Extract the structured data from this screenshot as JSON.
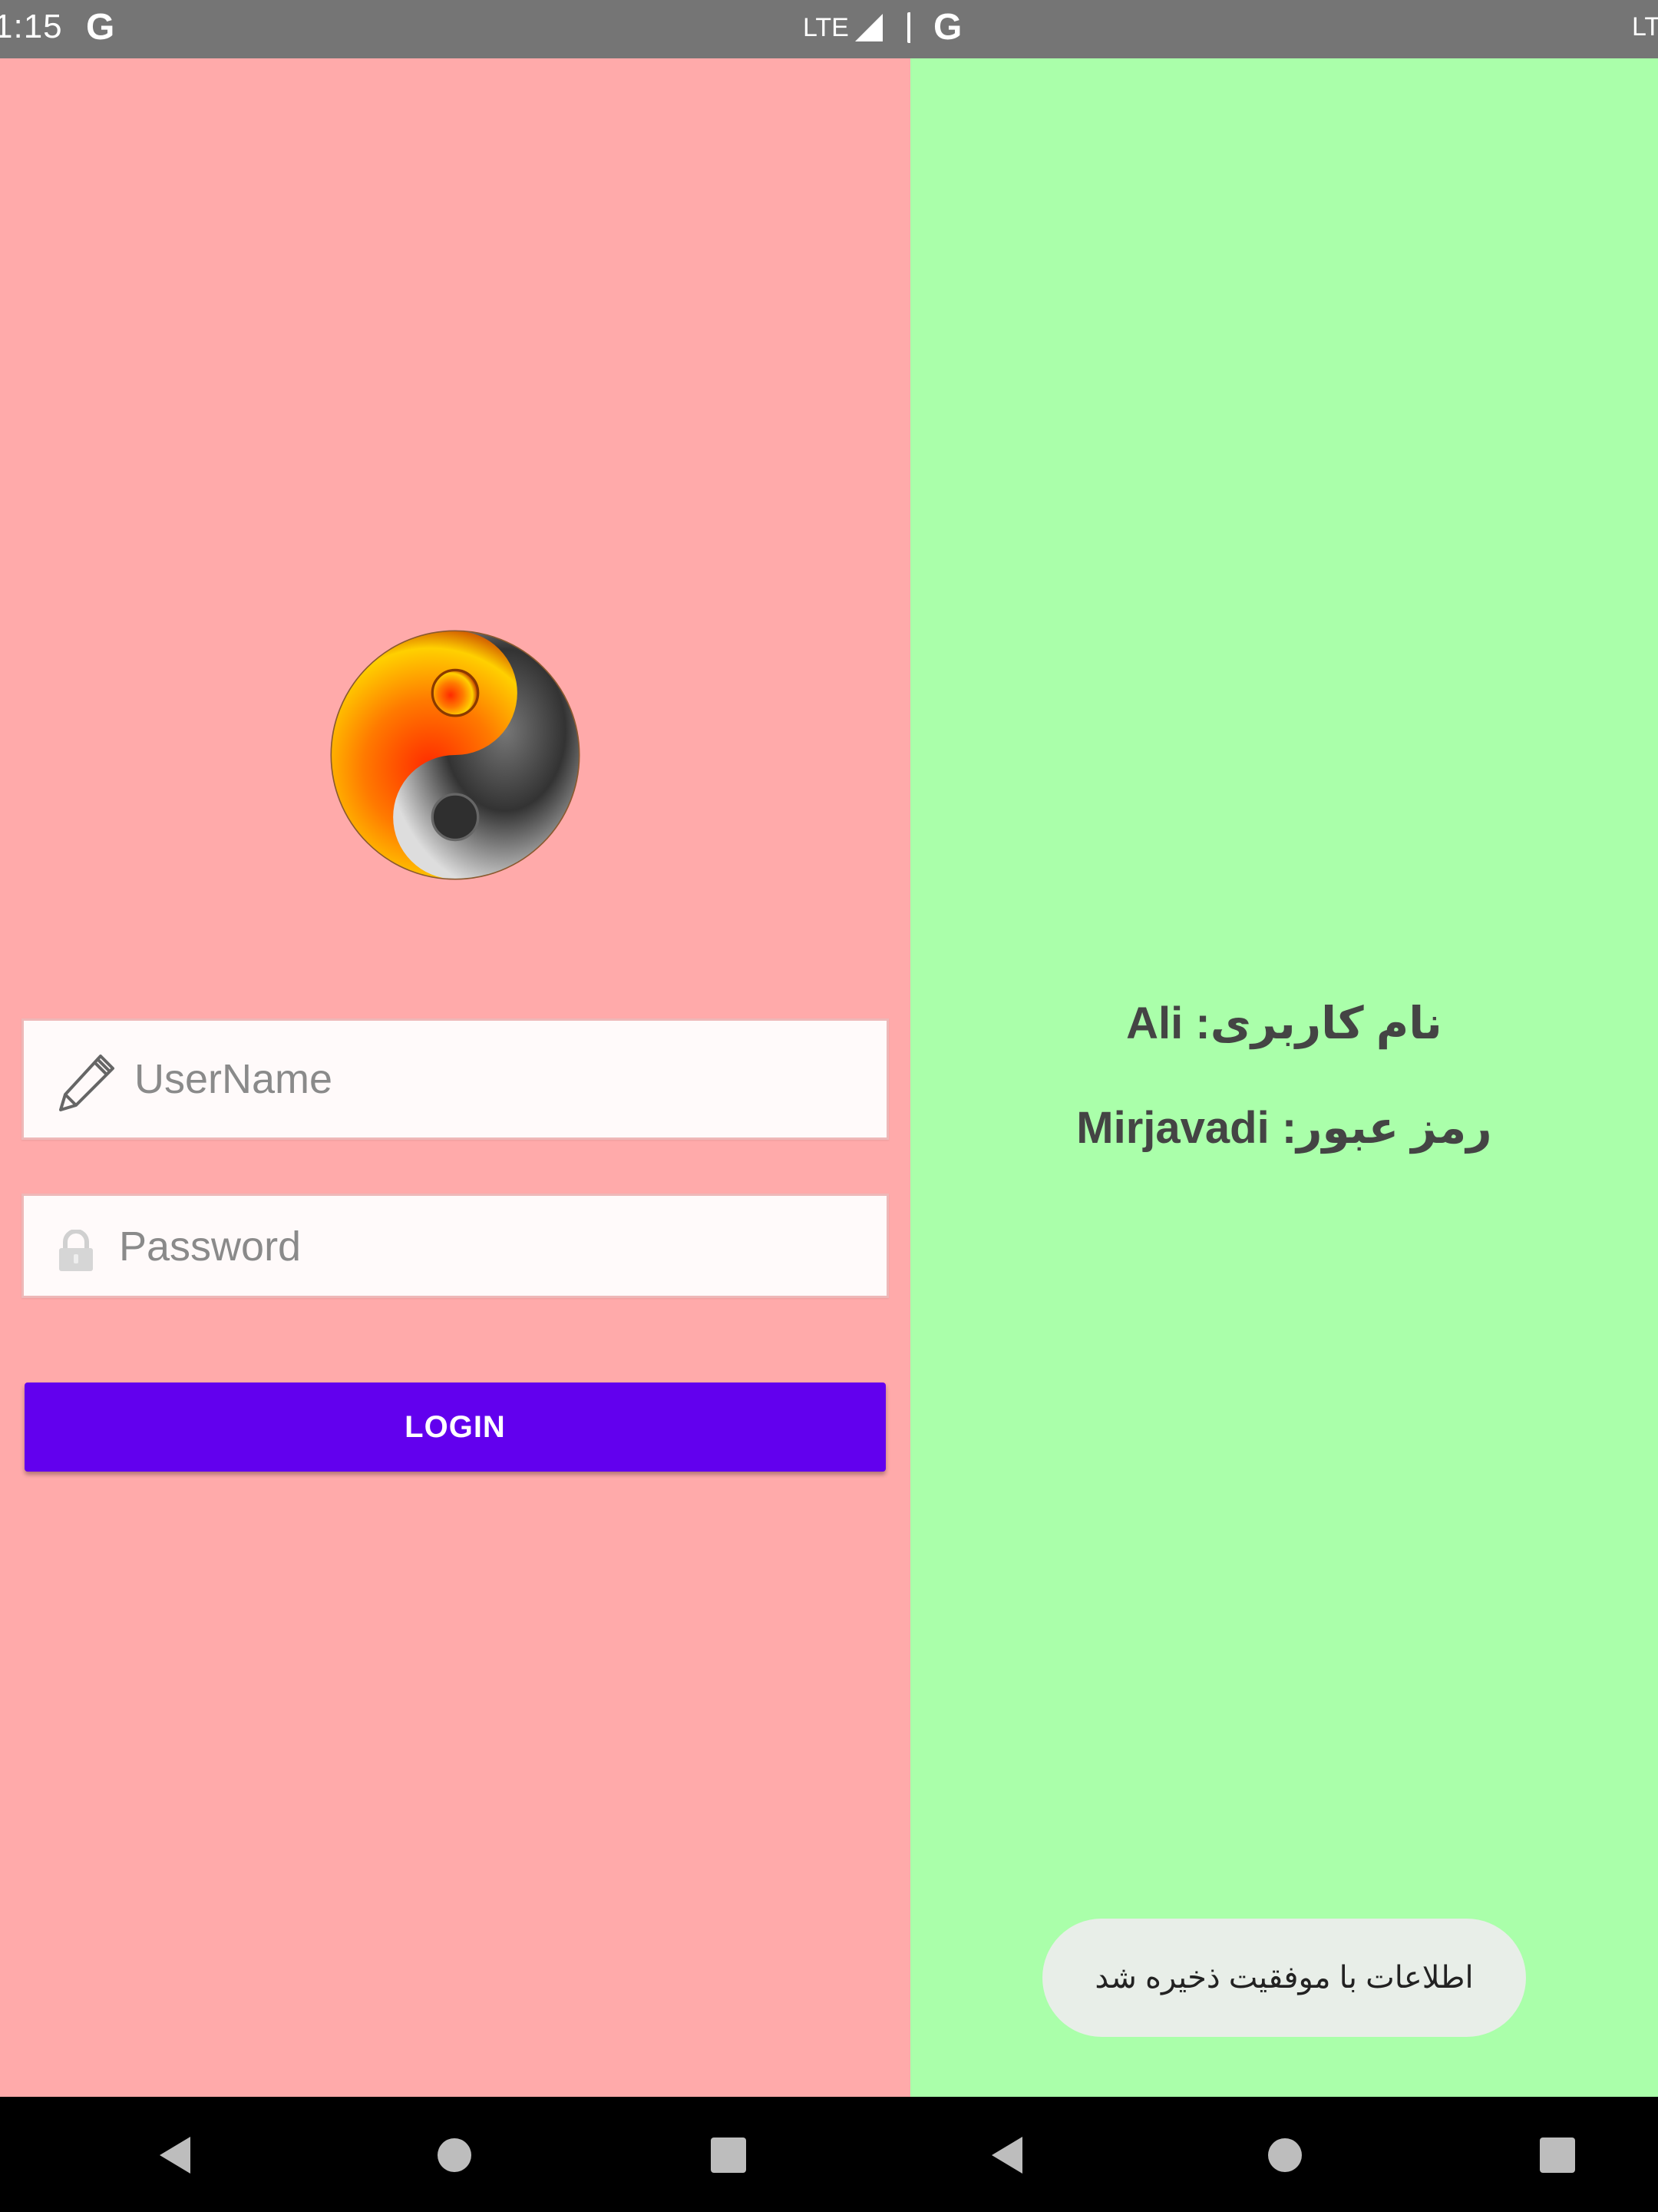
{
  "left_screen": {
    "status_bar": {
      "time": "1:15",
      "google_icon": "G",
      "network": "LTE",
      "signal_icon": "signal-icon",
      "battery_icon": "battery-icon"
    },
    "logo": {
      "icon": "yin-yang-fire-moon-logo"
    },
    "username": {
      "placeholder": "UserName",
      "icon": "pencil-icon"
    },
    "password": {
      "placeholder": "Password",
      "icon": "lock-icon"
    },
    "login_button": {
      "label": "LOGIN"
    },
    "background": "#ffaaaa",
    "accent": "#6200ee"
  },
  "right_screen": {
    "status_bar": {
      "google_icon": "G",
      "network": "LT"
    },
    "username_label": "نام کاربری:",
    "username_value": "Ali",
    "password_label": "رمز عبور:",
    "password_value": "Mirjavadi",
    "toast": "اطلاعات با موفقیت ذخیره شد",
    "background": "#aaffaa"
  },
  "nav_bar": {
    "back_icon": "back-icon",
    "home_icon": "home-icon",
    "recents_icon": "recents-icon"
  }
}
